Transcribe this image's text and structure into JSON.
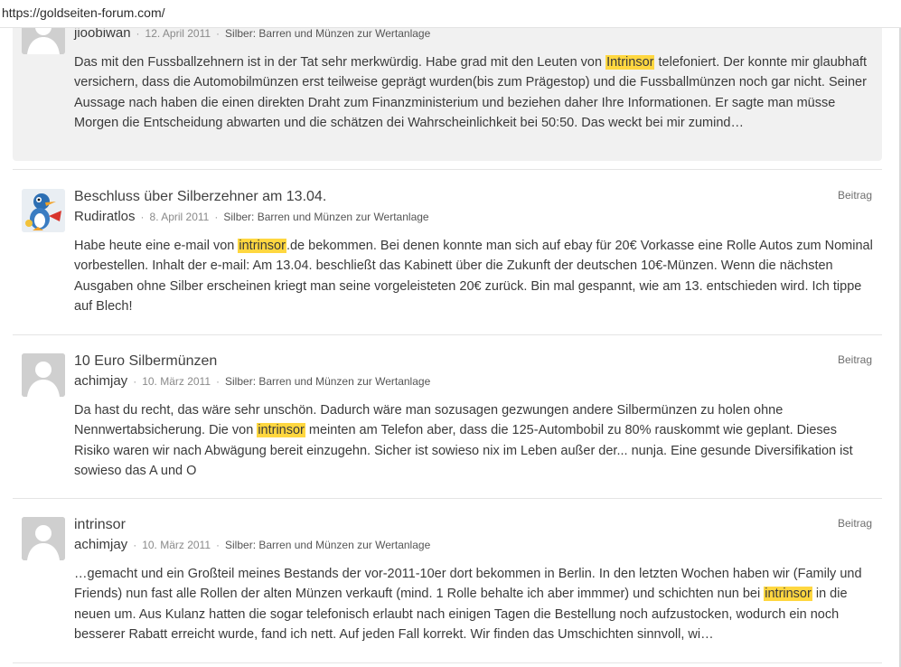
{
  "browser": {
    "url": "https://goldseiten-forum.com/"
  },
  "colors": {
    "highlight": "#ffd740",
    "card_bg": "#f1f1f1"
  },
  "posts": [
    {
      "title": "",
      "author": "jioobiwan",
      "date": "12. April 2011",
      "forum": "Silber: Barren und Münzen zur Wertanlage",
      "type": "",
      "avatar": "default-avatar-icon",
      "body_before": "Das mit den Fussballzehnern ist in der Tat sehr merkwürdig. Habe grad mit den Leuten von ",
      "highlight": "Intrinsor",
      "body_after": " telefoniert. Der konnte mir glaubhaft versichern, dass die Automobilmünzen erst teilweise geprägt wurden(bis zum Prägestop) und die Fussballmünzen noch gar nicht. Seiner Aussage nach haben die einen direkten Draht zum Finanzministerium und beziehen daher Ihre Informationen. Er sagte man müsse Morgen die Entscheidung abwarten und die schätzen dei Wahrscheinlichkeit bei 50:50. Das weckt bei mir zumind…"
    },
    {
      "title": "Beschluss über Silberzehner am 13.04.",
      "author": "Rudiratlos",
      "date": "8. April 2011",
      "forum": "Silber: Barren und Münzen zur Wertanlage",
      "type": "Beitrag",
      "avatar": "cartoon-bird-avatar-icon",
      "body_before": "Habe heute eine e-mail von ",
      "highlight": "intrinsor",
      "body_after": ".de bekommen. Bei denen konnte man sich auf ebay für 20€ Vorkasse eine Rolle Autos zum Nominal vorbestellen. Inhalt der e-mail: Am 13.04. beschließt das Kabinett über die Zukunft der deutschen 10€-Münzen. Wenn die nächsten Ausgaben ohne Silber erscheinen kriegt man seine vorgeleisteten 20€ zurück. Bin mal gespannt, wie am 13. entschieden wird. Ich tippe auf Blech!"
    },
    {
      "title": "10 Euro Silbermünzen",
      "author": "achimjay",
      "date": "10. März 2011",
      "forum": "Silber: Barren und Münzen zur Wertanlage",
      "type": "Beitrag",
      "avatar": "default-avatar-icon",
      "body_before": "Da hast du recht, das wäre sehr unschön. Dadurch wäre man sozusagen gezwungen andere Silbermünzen zu holen ohne Nennwertabsicherung. Die von ",
      "highlight": "intrinsor",
      "body_after": " meinten am Telefon aber, dass die 125-Autombobil zu 80% rauskommt wie geplant. Dieses Risiko waren wir nach Abwägung bereit einzugehn. Sicher ist sowieso nix im Leben außer der... nunja. Eine gesunde Diversifikation ist sowieso das A und O"
    },
    {
      "title": "intrinsor",
      "author": "achimjay",
      "date": "10. März 2011",
      "forum": "Silber: Barren und Münzen zur Wertanlage",
      "type": "Beitrag",
      "avatar": "default-avatar-icon",
      "body_before": "…gemacht und ein Großteil meines Bestands der vor-2011-10er dort bekommen in Berlin. In den letzten Wochen haben wir (Family und Friends) nun fast alle Rollen der alten Münzen verkauft (mind. 1 Rolle behalte ich aber immmer) und schichten nun bei ",
      "highlight": "intrinsor",
      "body_after": " in die neuen um. Aus Kulanz hatten die sogar telefonisch erlaubt nach einigen Tagen die Bestellung noch aufzustocken, wodurch ein noch besserer Rabatt erreicht wurde, fand ich nett. Auf jeden Fall korrekt. Wir finden das Umschichten sinnvoll, wi…"
    }
  ]
}
